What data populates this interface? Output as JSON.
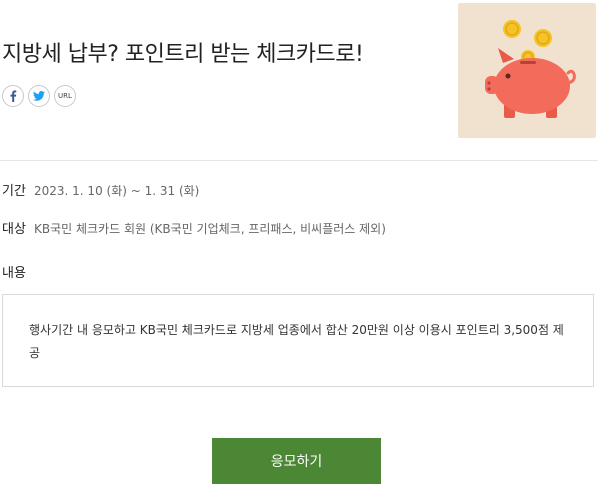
{
  "event": {
    "title": "지방세 납부? 포인트리 받는 체크카드로!",
    "share": {
      "facebook_icon": "facebook-icon",
      "twitter_icon": "twitter-icon",
      "url_label": "URL"
    },
    "thumbnail_icon": "piggy-bank-with-coins-icon",
    "period": {
      "label": "기간",
      "value": "2023. 1. 10 (화) ~ 1. 31 (화)"
    },
    "target": {
      "label": "대상",
      "value": "KB국민 체크카드 회원 (KB국민 기업체크, 프리패스, 비씨플러스 제외)"
    },
    "content": {
      "label": "내용",
      "text": "행사기간 내 응모하고 KB국민 체크카드로 지방세 업종에서 합산 20만원 이상 이용시 포인트리 3,500점 제공"
    },
    "apply_label": "응모하기"
  },
  "colors": {
    "accent_green": "#4c8736",
    "facebook_blue": "#3b5998",
    "twitter_blue": "#1da1f2",
    "thumbnail_bg": "#f1e2cf",
    "pig_pink": "#f26b5b",
    "coin_gold": "#f6c324"
  }
}
